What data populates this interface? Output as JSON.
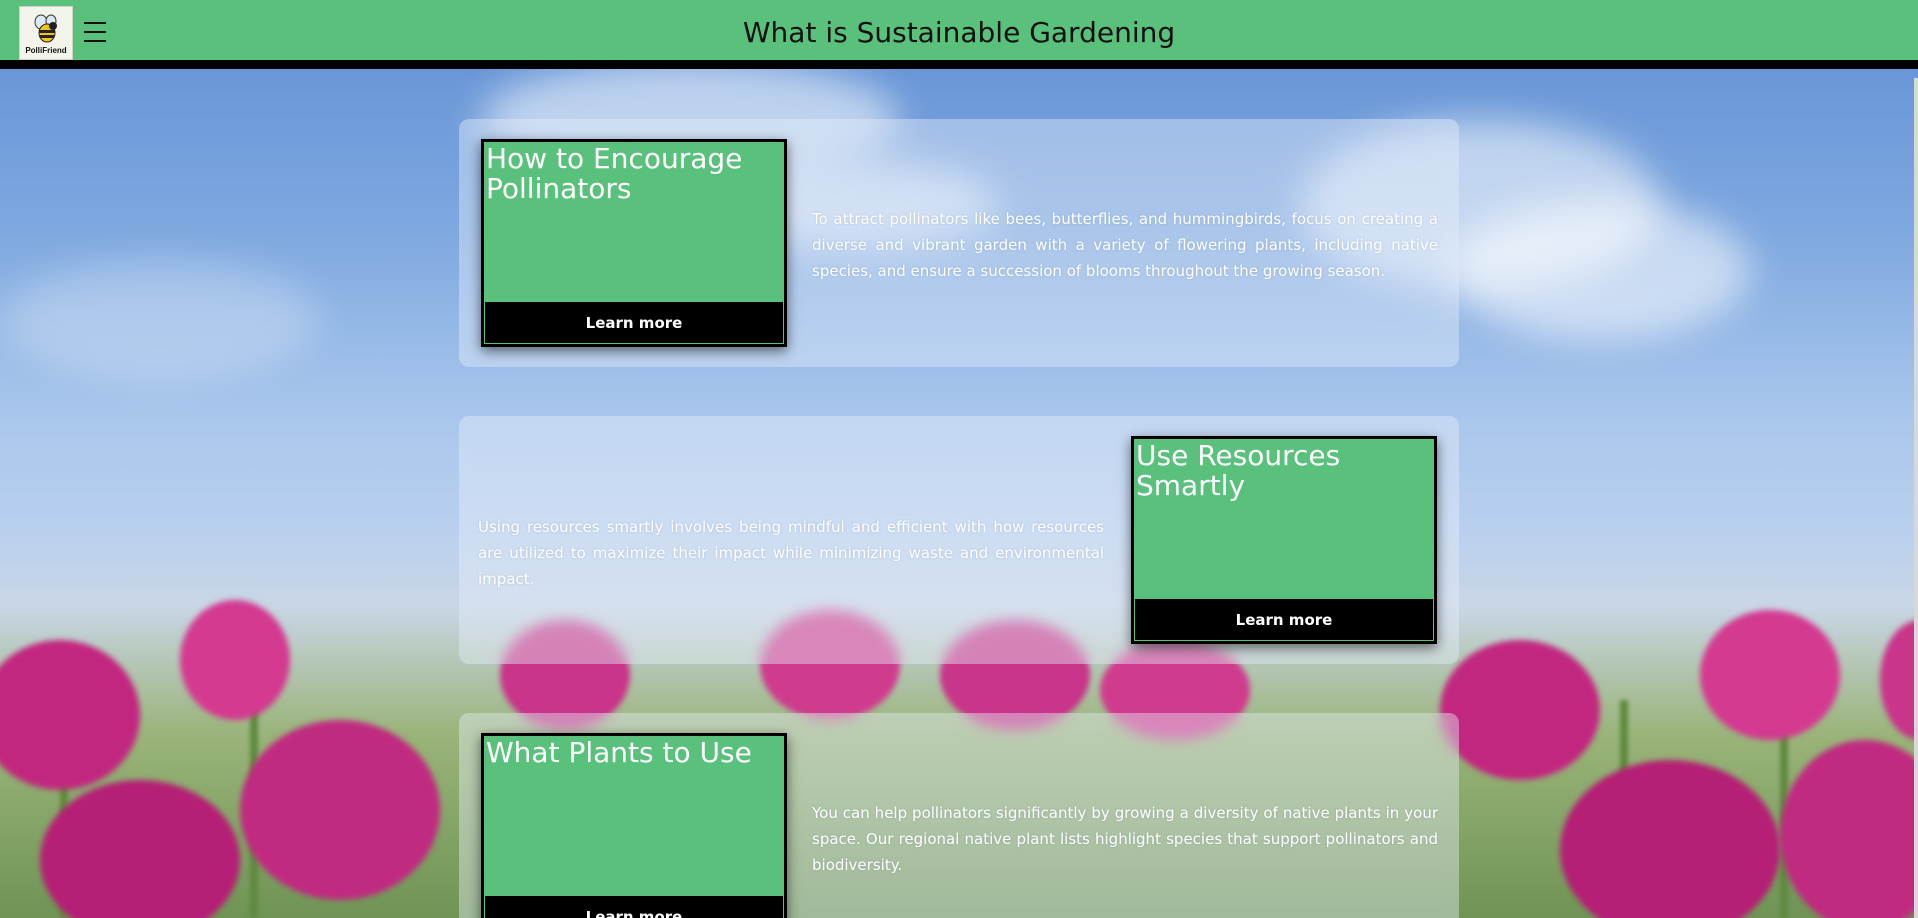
{
  "header": {
    "logo_text": "PolliFriend",
    "title": "What is Sustainable Gardening",
    "menu_icon": "hamburger-menu-icon",
    "background_color": "#5ac17c"
  },
  "sections": [
    {
      "card_title": "How to Encourage Pollinators",
      "button_label": "Learn more",
      "description": "To attract pollinators like bees, butterflies, and hummingbirds, focus on creating a diverse and vibrant garden with a variety of flowering plants, including native species, and ensure a succession of blooms throughout the growing season."
    },
    {
      "card_title": "Use Resources Smartly",
      "button_label": "Learn more",
      "description": "Using resources smartly involves being mindful and efficient with how resources are utilized to maximize their impact while minimizing waste and environmental impact."
    },
    {
      "card_title": "What Plants to Use",
      "button_label": "Learn more",
      "description": "You can help pollinators significantly by growing a diversity of native plants in your space. Our regional native plant lists highlight species that support pollinators and biodiversity."
    }
  ],
  "colors": {
    "accent_green": "#5ac17c",
    "button_black": "#000000"
  }
}
